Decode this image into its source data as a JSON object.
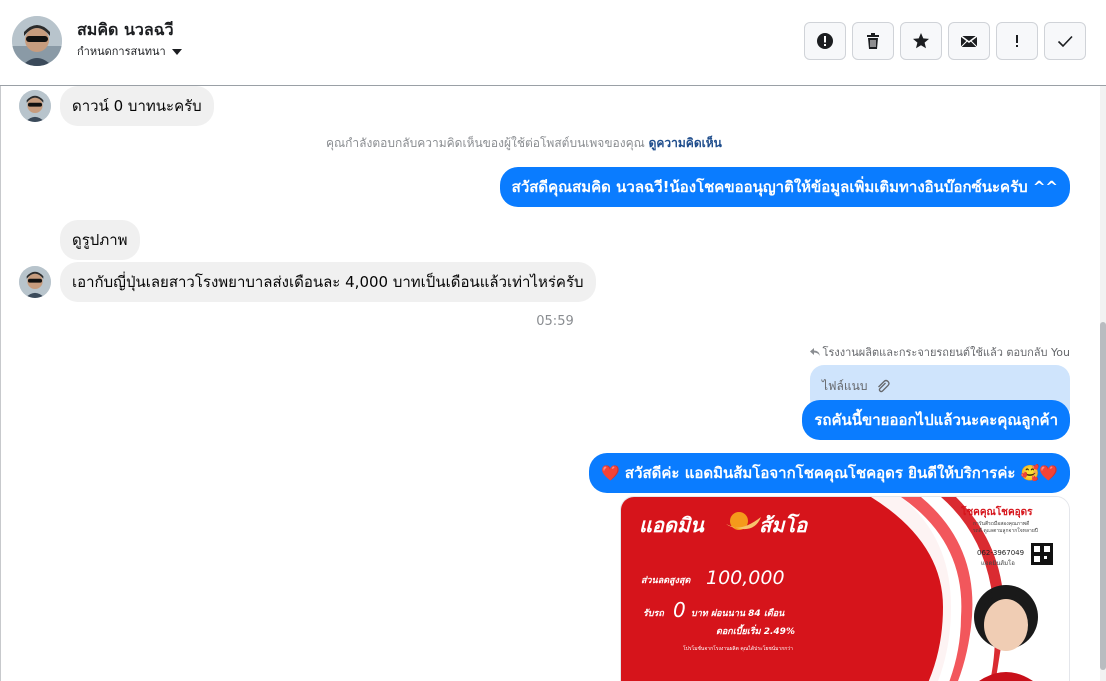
{
  "header": {
    "contact_name": "สมคิด นวลฉวี",
    "assign_label": "กำหนดการสนทนา"
  },
  "toolbar": {
    "buttons": [
      "alert-icon",
      "trash-icon",
      "star-icon",
      "envelope-icon",
      "exclamation-icon",
      "check-icon"
    ]
  },
  "messages": {
    "in1": "ดาวน์ 0 บาทนะครับ",
    "reply_note_prefix": "คุณกำลังตอบกลับความคิดเห็นของผู้ใช้ต่อโพสต์บนเพจของคุณ",
    "reply_note_link": "ดูความคิดเห็น",
    "out1": "สวัสดีคุณสมคิด นวลฉวี!น้องโชคขออนุญาติให้ข้อมูลเพิ่มเติมทางอินบ๊อกซ์นะครับ ^^",
    "in2": "ดูรูปภาพ",
    "in3": "เอากับญี่ปุ่นเลยสาวโรงพยาบาลส่งเดือนละ 4,000 บาทเป็นเดือนแล้วเท่าไหร่ครับ",
    "time": "05:59",
    "reply_to": "โรงงานผลิตและกระจายรถยนต์ใช้แล้ว ตอบกลับ You",
    "attachment_label": "ไฟล์แนบ",
    "out2": "รถคันนี้ขายออกไปแล้วนะคะคุณลูกค้า",
    "out3": "❤️ สวัสดีค่ะ แอดมินส้มโอจากโชคคุณโชคอุดร ยินดีให้บริการค่ะ 🥰❤️"
  },
  "promo_image": {
    "brand": "แอดมินส้มโอ",
    "company": "โชคคุณโชคอุดร",
    "company_sub1": "การันตีรถมือสองคุณภาพดี",
    "company_sub2": "รถดี ดูแลตามลูกจากใจหลายปี",
    "phone": "062-3967049",
    "admin_tag": "แอดมินส้มโอ",
    "line1_label": "ส่วนลดสูงสุด",
    "line1_value": "100,000",
    "line2_label": "รับรถ",
    "line2_value": "0",
    "line2_rest": "บาท ผ่อนนาน 84 เดือน",
    "line3": "ดอกเบี้ยเริ่ม 2.49%",
    "line4": "โปรโมชั่นจากโรงงานผลิต คุณได้ประโยชน์มากกว่า"
  },
  "colors": {
    "brand_blue": "#0a7cff",
    "promo_red": "#d6141b"
  }
}
